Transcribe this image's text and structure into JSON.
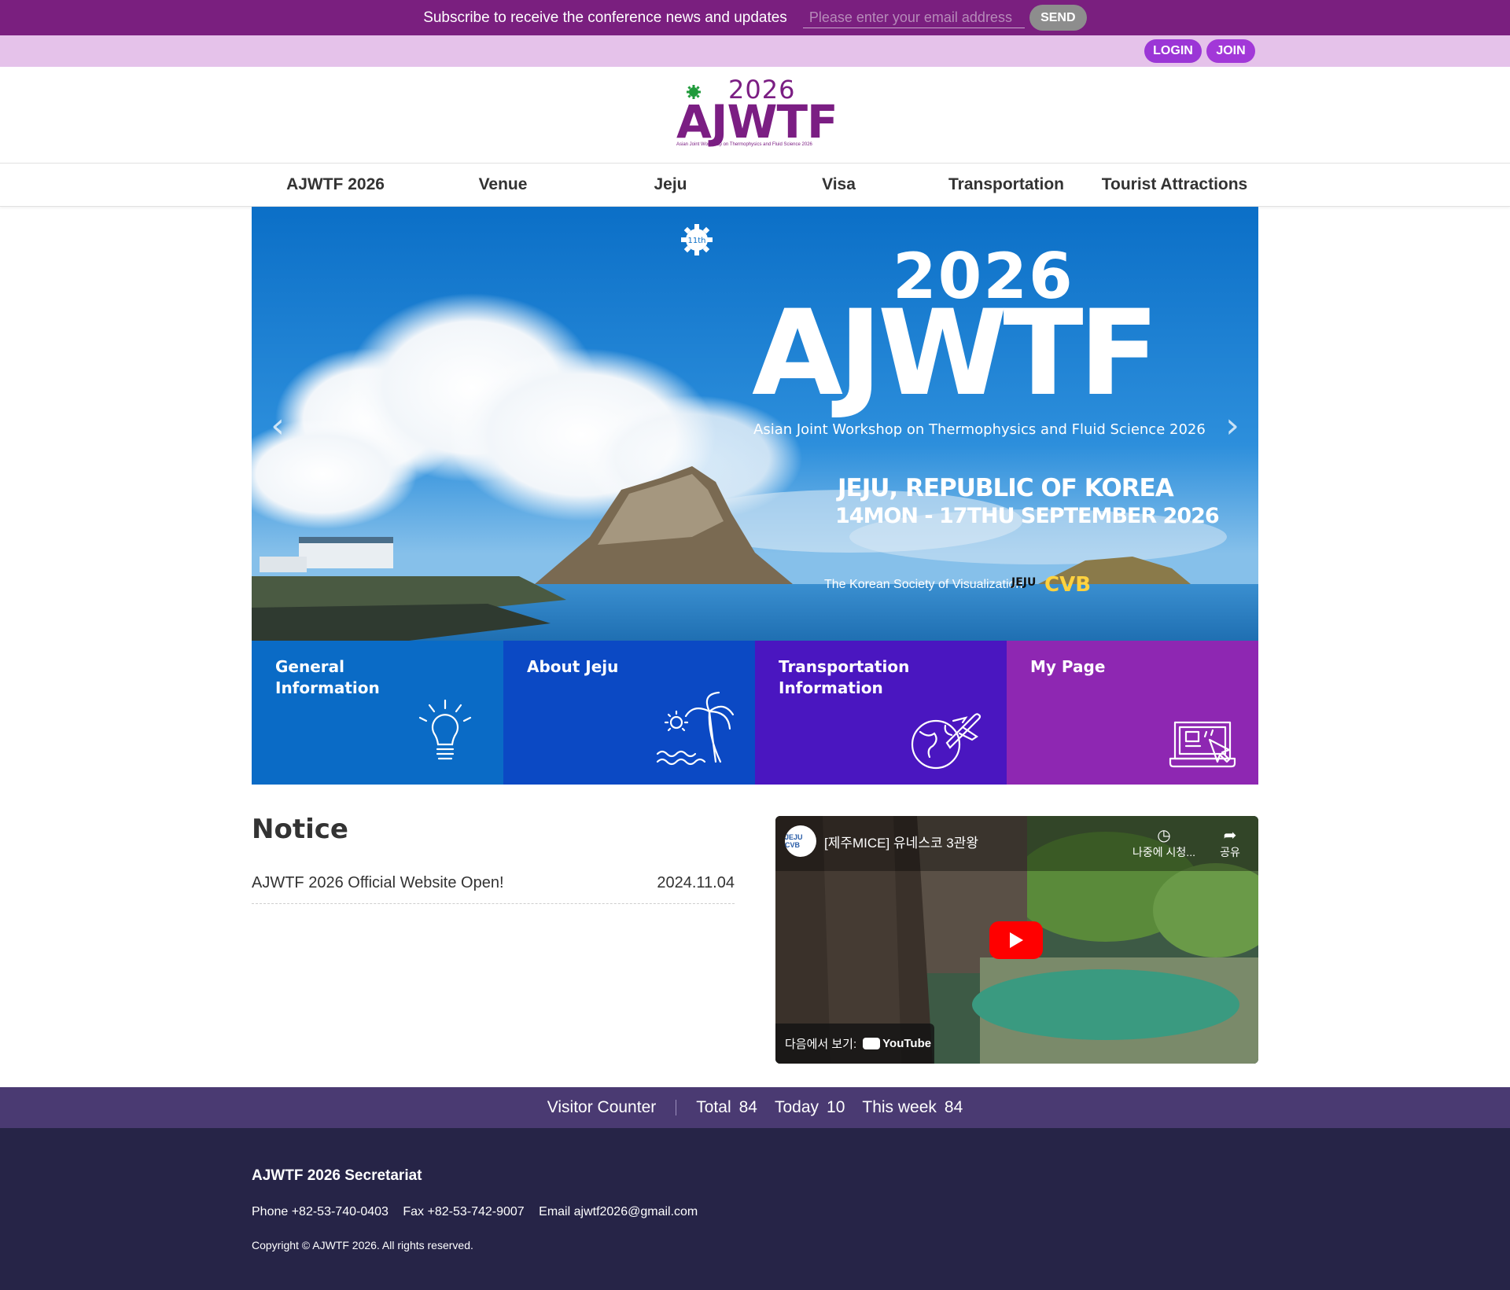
{
  "subscribe": {
    "text": "Subscribe to receive the conference news and updates",
    "placeholder": "Please enter your email address",
    "send_label": "SEND"
  },
  "account": {
    "login_label": "LOGIN",
    "join_label": "JOIN"
  },
  "logo": {
    "year": "2026",
    "name": "AJWTF",
    "subtitle": "Asian Joint Workshop on Thermophysics and Fluid Science 2026"
  },
  "nav": {
    "items": [
      {
        "label": "AJWTF 2026"
      },
      {
        "label": "Venue"
      },
      {
        "label": "Jeju"
      },
      {
        "label": "Visa"
      },
      {
        "label": "Transportation"
      },
      {
        "label": "Tourist Attractions"
      }
    ]
  },
  "hero": {
    "edition": "11th",
    "year": "2026",
    "name": "AJWTF",
    "subtitle": "Asian Joint Workshop on Thermophysics and Fluid Science 2026",
    "location": "JEJU, REPUBLIC OF KOREA",
    "date": "14MON - 17THU SEPTEMBER 2026",
    "organizer": "The Korean Society of Visualization",
    "jeju_label": "JEJU",
    "cvb_label": "CVB",
    "prev_icon": "chevron-left-icon",
    "next_icon": "chevron-right-icon"
  },
  "tiles": [
    {
      "label": "General\nInformation",
      "icon": "lightbulb-icon",
      "color": "#0a6bc6"
    },
    {
      "label": "About Jeju",
      "icon": "palm-tree-icon",
      "color": "#0b49c4"
    },
    {
      "label": "Transportation\nInformation",
      "icon": "globe-plane-icon",
      "color": "#4a16c0"
    },
    {
      "label": "My Page",
      "icon": "laptop-icon",
      "color": "#8e27b2"
    }
  ],
  "notice": {
    "title": "Notice",
    "items": [
      {
        "text": "AJWTF 2026 Official Website Open!",
        "date": "2024.11.04"
      }
    ]
  },
  "video": {
    "title": "[제주MICE] 유네스코 3관왕",
    "channel": "JEJU CVB",
    "watch_later": "나중에 시청...",
    "share": "공유",
    "watch_on": "다음에서 보기:",
    "youtube": "YouTube"
  },
  "counter": {
    "title": "Visitor Counter",
    "total_label": "Total",
    "total": "84",
    "today_label": "Today",
    "today": "10",
    "week_label": "This week",
    "week": "84"
  },
  "footer": {
    "title": "AJWTF 2026 Secretariat",
    "phone": "Phone +82-53-740-0403",
    "fax": "Fax +82-53-742-9007",
    "email": "Email ajwtf2026@gmail.com",
    "copyright": "Copyright © AJWTF 2026. All rights reserved."
  }
}
